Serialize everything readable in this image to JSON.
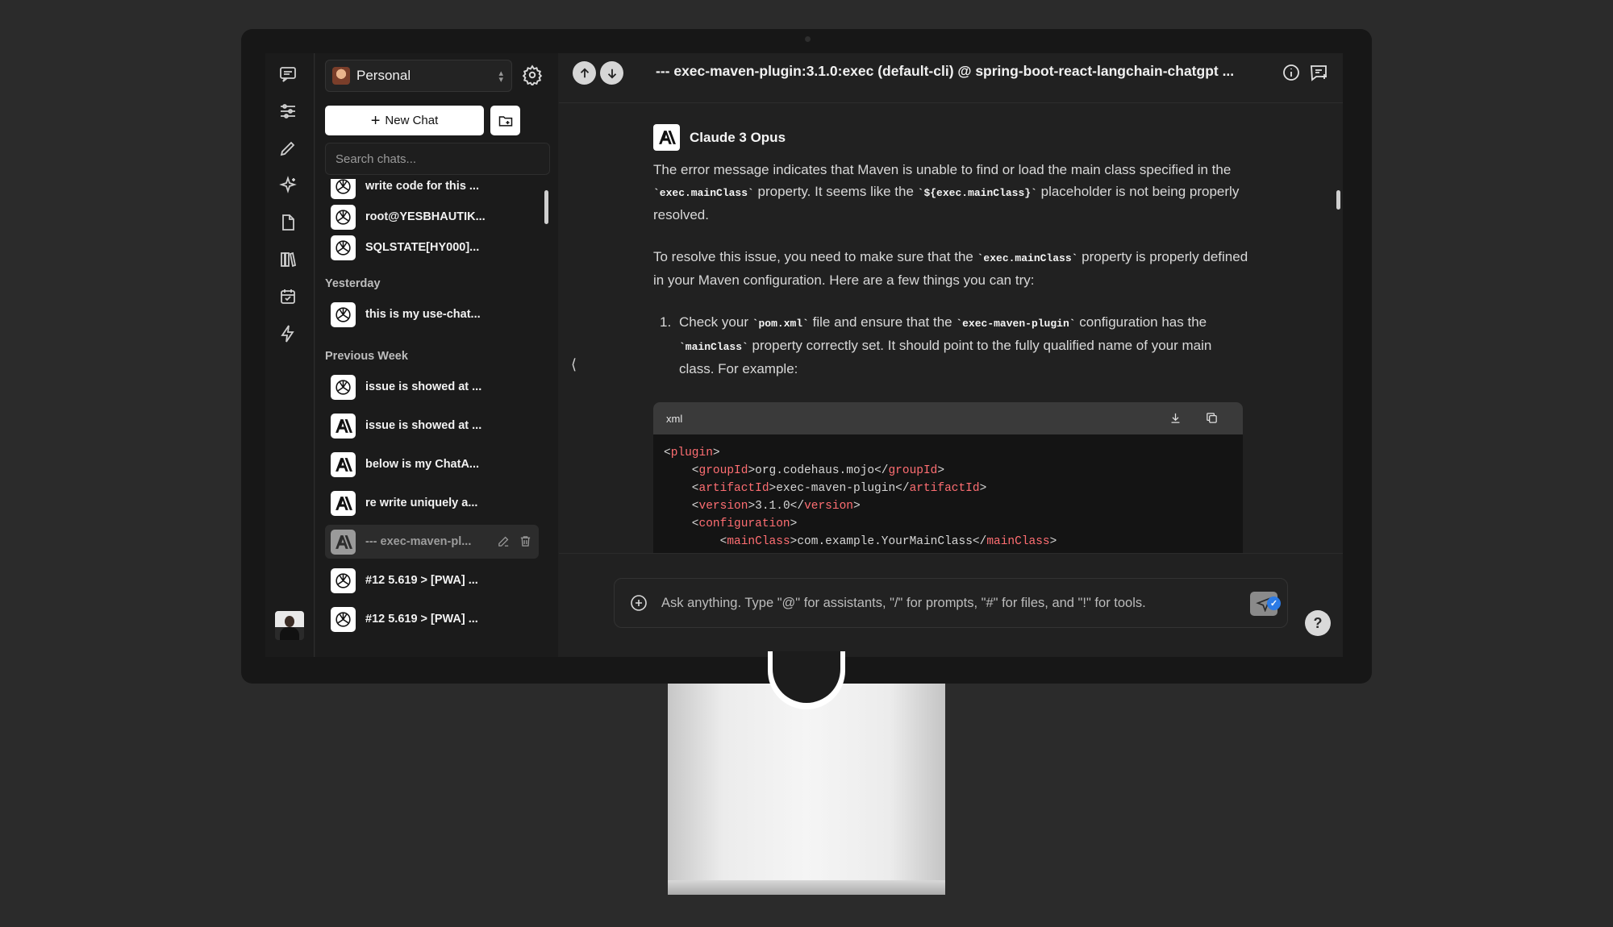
{
  "workspace": {
    "name": "Personal"
  },
  "sidebar": {
    "new_chat_label": "New Chat",
    "search_placeholder": "Search chats...",
    "groups": {
      "yesterday": "Yesterday",
      "previous_week": "Previous Week"
    },
    "items": [
      {
        "label": "write code for this ...",
        "icon": "openai-icon"
      },
      {
        "label": "root@YESBHAUTIK...",
        "icon": "openai-icon"
      },
      {
        "label": "SQLSTATE[HY000]...",
        "icon": "openai-icon"
      },
      {
        "label": "this is my use-chat...",
        "icon": "openai-icon"
      },
      {
        "label": "issue is showed at ...",
        "icon": "openai-icon"
      },
      {
        "label": "issue is showed at ...",
        "icon": "anthropic-icon"
      },
      {
        "label": "below is my ChatA...",
        "icon": "anthropic-icon"
      },
      {
        "label": "re write uniquely a...",
        "icon": "anthropic-icon"
      },
      {
        "label": "--- exec-maven-pl...",
        "icon": "anthropic-icon",
        "active": true
      },
      {
        "label": "#12 5.619 > [PWA] ...",
        "icon": "openai-icon"
      },
      {
        "label": "#12 5.619 > [PWA] ...",
        "icon": "openai-icon"
      }
    ]
  },
  "header": {
    "title": "--- exec-maven-plugin:3.1.0:exec (default-cli) @ spring-boot-react-langchain-chatgpt ..."
  },
  "message": {
    "model_name": "Claude 3 Opus",
    "p1": {
      "a": "The error message indicates that Maven is unable to find or load the main class specified in the ",
      "code1": "`exec.mainClass`",
      "b": " property. It seems like the ",
      "code2": "`${exec.mainClass}`",
      "c": " placeholder is not being properly resolved."
    },
    "p2": {
      "a": "To resolve this issue, you need to make sure that the ",
      "code1": "`exec.mainClass`",
      "b": " property is properly defined in your Maven configuration. Here are a few things you can try:"
    },
    "li1": {
      "num": "1.",
      "a": "Check your ",
      "code1": "`pom.xml`",
      "b": " file and ensure that the ",
      "code2": "`exec-maven-plugin`",
      "c": " configuration has the ",
      "code3": "`mainClass`",
      "d": " property correctly set. It should point to the fully qualified name of your main class. For example:"
    }
  },
  "code": {
    "language": "xml",
    "lines": [
      {
        "indent": "",
        "tag": "plugin",
        "text": "",
        "close": false
      },
      {
        "indent": "    ",
        "tag": "groupId",
        "text": "org.codehaus.mojo",
        "close": true
      },
      {
        "indent": "    ",
        "tag": "artifactId",
        "text": "exec-maven-plugin",
        "close": true
      },
      {
        "indent": "    ",
        "tag": "version",
        "text": "3.1.0",
        "close": true
      },
      {
        "indent": "    ",
        "tag": "configuration",
        "text": "",
        "close": false
      },
      {
        "indent": "        ",
        "tag": "mainClass",
        "text": "com.example.YourMainClass",
        "close": true
      }
    ]
  },
  "input": {
    "placeholder": "Ask anything. Type \"@\" for assistants, \"/\" for prompts, \"#\" for files, and \"!\" for tools."
  },
  "help_label": "?"
}
